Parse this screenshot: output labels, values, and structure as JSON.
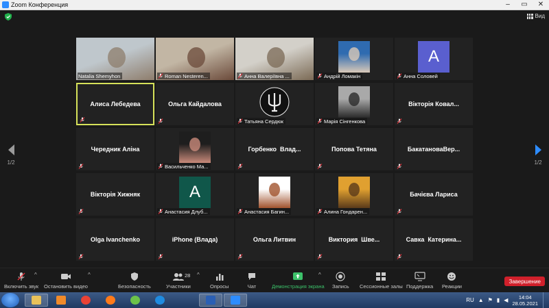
{
  "window": {
    "title": "Zoom Конференция",
    "controls": [
      "‒",
      "▭",
      "✕"
    ]
  },
  "top_bar": {
    "view_label": "Вид"
  },
  "pagination": {
    "label": "1/2"
  },
  "participants": [
    {
      "name": "Natalia Shemyhon",
      "kind": "video",
      "muted": false,
      "active": false,
      "colors": [
        "#bfc7cc",
        "#8e7d6c"
      ]
    },
    {
      "name": "Roman Nesteren...",
      "kind": "video",
      "muted": true,
      "active": false,
      "colors": [
        "#c2b6a4",
        "#6b4a3a"
      ]
    },
    {
      "name": "Анна Валеріївна ...",
      "kind": "video",
      "muted": true,
      "active": false,
      "colors": [
        "#d3d0c9",
        "#7b6a55"
      ]
    },
    {
      "name": "Андрій Ломакін",
      "kind": "photo",
      "muted": true,
      "active": false,
      "colors": [
        "#2f6bb0",
        "#d9c9b8"
      ]
    },
    {
      "name": "Анна Соловей",
      "kind": "avatar",
      "letter": "A",
      "muted": true,
      "active": false,
      "colors": [
        "#5a5fcf"
      ]
    },
    {
      "name": "Алиса Лебедева",
      "kind": "name",
      "muted": true,
      "active": true
    },
    {
      "name": "Ольга Кайдалова",
      "kind": "name",
      "muted": true,
      "active": false
    },
    {
      "name": "Татьяна Сердюк",
      "kind": "logo",
      "muted": true,
      "active": false,
      "colors": [
        "#111111",
        "#eeeeee"
      ]
    },
    {
      "name": "Марія Сінгенкова",
      "kind": "photo",
      "muted": true,
      "active": false,
      "colors": [
        "#a9a9a9",
        "#2a2a2a"
      ]
    },
    {
      "name": "Вікторія Ковал...",
      "kind": "name",
      "muted": true,
      "active": false
    },
    {
      "name": "Чередник Аліна",
      "kind": "name",
      "muted": true,
      "active": false
    },
    {
      "name": "Васильченко Ма...",
      "kind": "photo",
      "muted": true,
      "active": false,
      "colors": [
        "#1e1e1e",
        "#c98a7a"
      ]
    },
    {
      "name": "Горбенко  Влад...",
      "kind": "name",
      "muted": true,
      "active": false
    },
    {
      "name": "Попова Тетяна",
      "kind": "name",
      "muted": true,
      "active": false
    },
    {
      "name": "БакатановаВер...",
      "kind": "name",
      "muted": true,
      "active": false
    },
    {
      "name": "Вікторія Хижняк",
      "kind": "name",
      "muted": true,
      "active": false
    },
    {
      "name": "Анастасия Длуб...",
      "kind": "avatar",
      "letter": "A",
      "muted": true,
      "active": false,
      "colors": [
        "#10574a"
      ]
    },
    {
      "name": "Анастасия Багин...",
      "kind": "photo",
      "muted": true,
      "active": false,
      "colors": [
        "#ffffff",
        "#a0522d"
      ]
    },
    {
      "name": "Алина Гондарен...",
      "kind": "photo",
      "muted": true,
      "active": false,
      "colors": [
        "#e0a030",
        "#5a3a1a"
      ]
    },
    {
      "name": "Бачієва Лариса",
      "kind": "name",
      "muted": true,
      "active": false
    },
    {
      "name": "Olga Ivanchenko",
      "kind": "name",
      "muted": true,
      "active": false
    },
    {
      "name": "iPhone (Влада)",
      "kind": "name",
      "muted": true,
      "active": false
    },
    {
      "name": "Ольга Литвин",
      "kind": "name",
      "muted": true,
      "active": false
    },
    {
      "name": "Виктория  Шве...",
      "kind": "name",
      "muted": true,
      "active": false
    },
    {
      "name": "Савка  Катерина...",
      "kind": "name",
      "muted": true,
      "active": false
    }
  ],
  "toolbar": {
    "unmute": "Включить звук",
    "stop_video": "Остановить видео",
    "security": "Безопасность",
    "participants": "Участники",
    "participants_count": "28",
    "polls": "Опросы",
    "chat": "Чат",
    "share": "Демонстрация экрана",
    "record": "Запись",
    "breakout": "Сессионные залы",
    "support": "Поддержка",
    "reactions": "Реакции",
    "end": "Завершение"
  },
  "taskbar": {
    "language": "RU",
    "time": "14:04",
    "date": "28.05.2021",
    "apps": [
      {
        "name": "explorer",
        "color": "#e8c15a"
      },
      {
        "name": "media-player",
        "color": "#f08a2a"
      },
      {
        "name": "chrome",
        "color": "#e94235"
      },
      {
        "name": "firefox",
        "color": "#ff7a1a"
      },
      {
        "name": "green-app",
        "color": "#6cc24a"
      },
      {
        "name": "edge",
        "color": "#1f8be0"
      },
      {
        "name": "word",
        "color": "#2b5fb4"
      },
      {
        "name": "zoom",
        "color": "#2d8cff"
      }
    ]
  }
}
